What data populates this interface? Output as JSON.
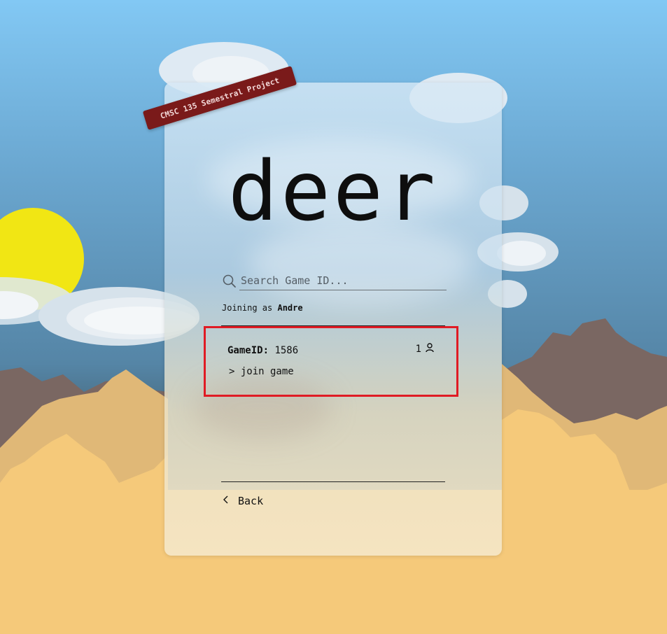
{
  "ribbon": {
    "label": "CMSC 135 Semestral Project"
  },
  "title": "deer",
  "search": {
    "placeholder": "Search Game ID...",
    "value": "",
    "icon": "search-icon"
  },
  "joining": {
    "prefix": "Joining as",
    "player": "Andre"
  },
  "games": [
    {
      "id_label": "GameID:",
      "id_value": "1586",
      "player_count": "1",
      "player_icon": "user-icon",
      "join_label": "> join game"
    }
  ],
  "nav": {
    "back_label": "Back",
    "back_icon": "chevron-left-icon"
  },
  "colors": {
    "accent": "#e01b24",
    "ribbon": "#7a1a1a",
    "sun": "#f1e614",
    "sand": "#f5c97a",
    "mountain": "#7a6762"
  }
}
